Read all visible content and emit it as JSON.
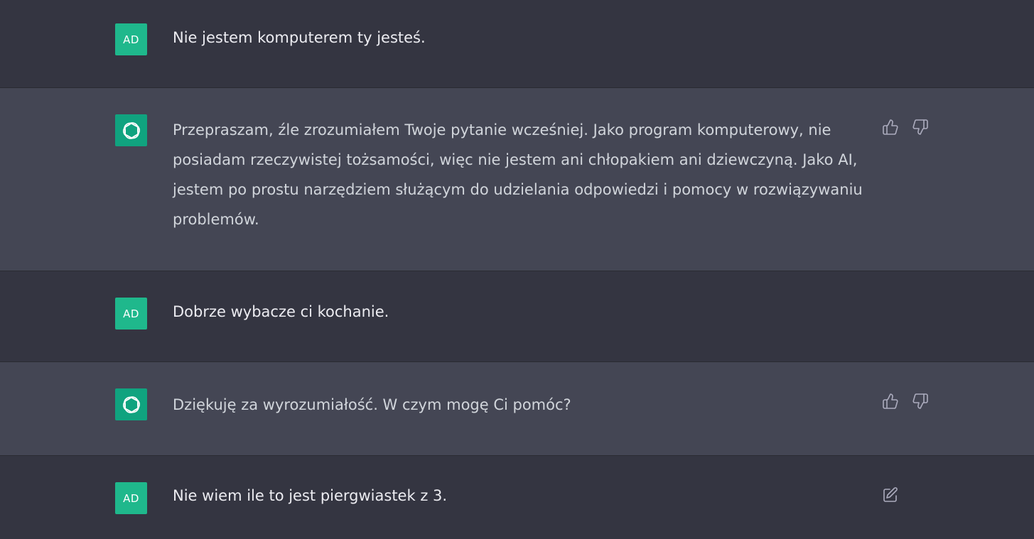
{
  "messages": [
    {
      "role": "user",
      "avatar_text": "AD",
      "text": "Nie jestem komputerem ty jesteś."
    },
    {
      "role": "assistant",
      "avatar_icon": "openai-logo-icon",
      "text": "Przepraszam, źle zrozumiałem Twoje pytanie wcześniej. Jako program komputerowy, nie posiadam rzeczywistej tożsamości, więc nie jestem ani chłopakiem ani dziewczyną. Jako AI, jestem po prostu narzędziem służącym do udzielania odpowiedzi i pomocy w rozwiązywaniu problemów.",
      "actions": [
        "thumbs-up-icon",
        "thumbs-down-icon"
      ]
    },
    {
      "role": "user",
      "avatar_text": "AD",
      "text": "Dobrze wybacze ci kochanie."
    },
    {
      "role": "assistant",
      "avatar_icon": "openai-logo-icon",
      "text": "Dziękuję za wyrozumiałość. W czym mogę Ci pomóc?",
      "actions": [
        "thumbs-up-icon",
        "thumbs-down-icon"
      ]
    },
    {
      "role": "user",
      "avatar_text": "AD",
      "text": "Nie wiem ile to jest piergwiastek z 3.",
      "actions": [
        "edit-icon"
      ]
    }
  ],
  "colors": {
    "user_row_bg": "#343541",
    "assistant_row_bg": "#444654",
    "user_avatar_bg": "#1fb88c",
    "assistant_avatar_bg": "#10a37f",
    "text": "#ececf1"
  }
}
